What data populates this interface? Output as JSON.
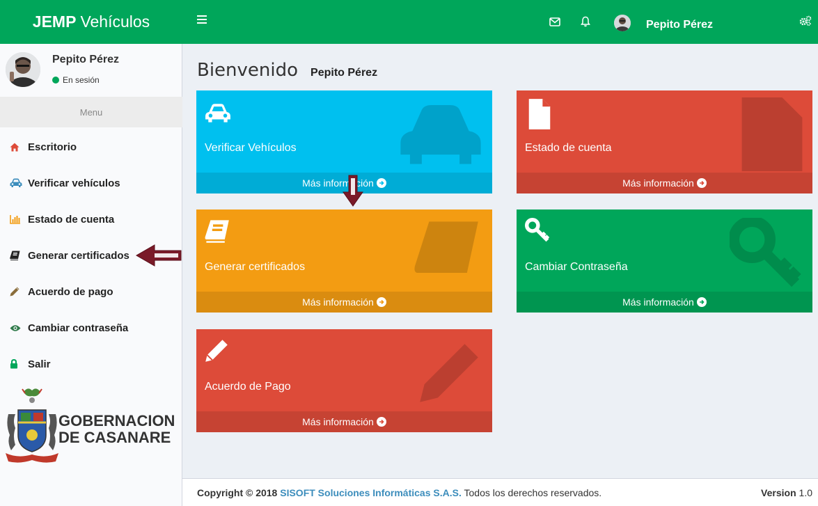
{
  "header": {
    "logo_bold": "JEMP",
    "logo_rest": "Vehículos",
    "user_name": "Pepito Pérez",
    "color": "#00a65a"
  },
  "sidebar": {
    "user_name": "Pepito Pérez",
    "status": "En sesión",
    "menu_header": "Menu",
    "items": [
      {
        "label": "Escritorio",
        "icon": "home-icon"
      },
      {
        "label": "Verificar vehículos",
        "icon": "car-icon"
      },
      {
        "label": "Estado de cuenta",
        "icon": "bar-chart-icon"
      },
      {
        "label": "Generar certificados",
        "icon": "book-icon"
      },
      {
        "label": "Acuerdo de pago",
        "icon": "pencil-icon"
      },
      {
        "label": "Cambiar contraseña",
        "icon": "eye-icon"
      },
      {
        "label": "Salir",
        "icon": "lock-icon"
      }
    ],
    "logo_line1": "GOBERNACION",
    "logo_line2": "DE CASANARE"
  },
  "main": {
    "title": "Bienvenido",
    "subtitle": "Pepito Pérez",
    "boxes": [
      {
        "label": "Verificar Vehículos",
        "footer": "Más información",
        "color": "#00c0ef",
        "icon": "car-icon"
      },
      {
        "label": "Estado de cuenta",
        "footer": "Más información",
        "color": "#dd4b39",
        "icon": "file-icon"
      },
      {
        "label": "Generar certificados",
        "footer": "Más información",
        "color": "#f39c12",
        "icon": "book-icon"
      },
      {
        "label": "Cambiar Contraseña",
        "footer": "Más información",
        "color": "#00a65a",
        "icon": "key-icon"
      },
      {
        "label": "Acuerdo de Pago",
        "footer": "Más información",
        "color": "#dd4b39",
        "icon": "pencil-icon"
      }
    ]
  },
  "footer": {
    "copyright_prefix": "Copyright © 2018",
    "company": "SISOFT Soluciones Informáticas S.A.S.",
    "rights": "Todos los derechos reservados.",
    "version_label": "Version",
    "version_value": "1.0"
  }
}
